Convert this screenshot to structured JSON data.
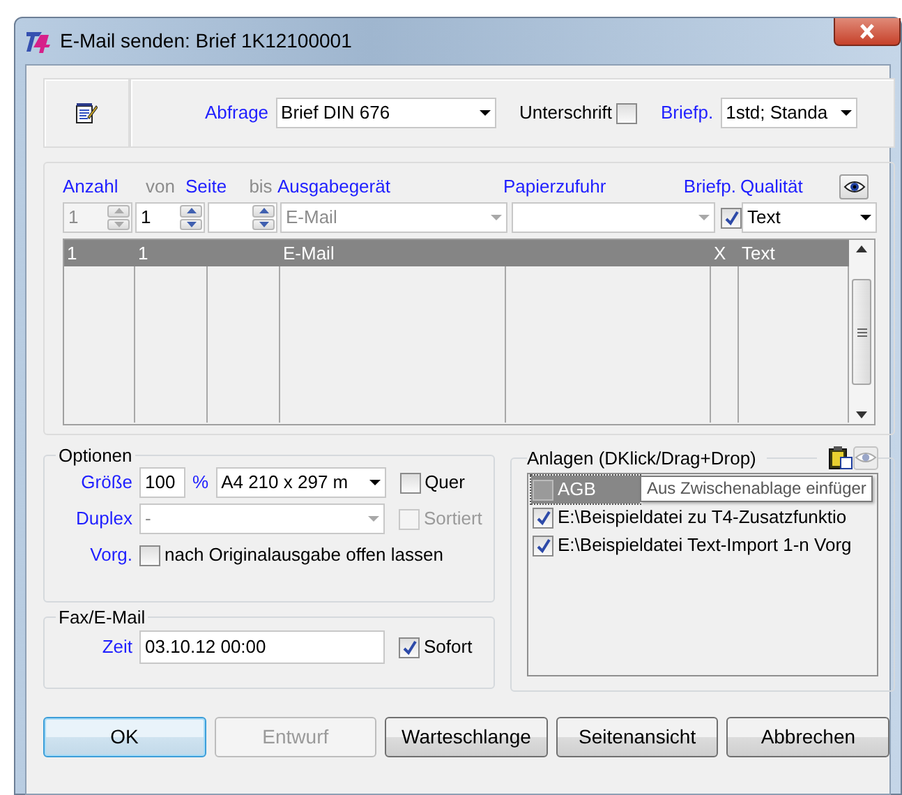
{
  "window": {
    "title": "E-Mail senden: Brief 1K12100001"
  },
  "query": {
    "label": "Abfrage",
    "value": "Brief DIN 676",
    "signature": {
      "label": "Unterschrift",
      "checked": false
    },
    "letterhead_label": "Briefp.",
    "letterhead_value": "1std; Standa"
  },
  "output": {
    "header_labels": [
      {
        "label": "Anzahl",
        "disabled": false
      },
      {
        "label": "von",
        "disabled": true
      },
      {
        "label": "Seite",
        "disabled": false
      },
      {
        "label": "bis",
        "disabled": true
      },
      {
        "label": "Ausgabegerät",
        "disabled": false
      },
      {
        "label": "Papierzufuhr",
        "disabled": false
      },
      {
        "label": "Briefp.",
        "disabled": false
      },
      {
        "label": "Qualität",
        "disabled": false
      }
    ],
    "editor": {
      "count": {
        "value": "1",
        "disabled": true
      },
      "from": {
        "value": "1",
        "disabled": false
      },
      "to": {
        "disabled": false
      },
      "device": {
        "value": "E-Mail",
        "disabled": true
      },
      "paper": {
        "disabled": true
      },
      "letterhead": {
        "checked": true
      },
      "quality": {
        "value": "Text"
      }
    },
    "list_rows": [
      {
        "cells": [
          "1",
          "1",
          "",
          "E-Mail",
          "",
          "X",
          "Text"
        ],
        "selected": true
      }
    ]
  },
  "options": {
    "title": "Optionen",
    "size_label": "Größe",
    "size_value": "100",
    "percent": "%",
    "format": "A4 210 x 297 m",
    "landscape": {
      "label": "Quer",
      "checked": false,
      "disabled": false
    },
    "duplex_label": "Duplex",
    "duplex_value": "-",
    "duplex_disabled": true,
    "sorted": {
      "label": "Sortiert",
      "checked": false,
      "disabled": true
    },
    "preset_label": "Vorg.",
    "keep_open": {
      "label": "nach Originalausgabe offen lassen",
      "checked": false
    }
  },
  "fax": {
    "title": "Fax/E-Mail",
    "time_label": "Zeit",
    "time_value": "03.10.12 00:00",
    "immediate": {
      "label": "Sofort",
      "checked": true
    }
  },
  "attachments": {
    "title": "Anlagen (DKlick/Drag+Drop)",
    "items": [
      {
        "label": "AGB",
        "checked": false,
        "selected": true
      },
      {
        "label": "E:\\Beispieldatei zu T4-Zusatzfunktio",
        "checked": true,
        "selected": false
      },
      {
        "label": "E:\\Beispieldatei Text-Import 1-n Vorg",
        "checked": true,
        "selected": false
      }
    ],
    "tooltip": "Aus Zwischenablage einfüger"
  },
  "buttons": [
    {
      "label": "OK",
      "default": true,
      "disabled": false
    },
    {
      "label": "Entwurf",
      "default": false,
      "disabled": true
    },
    {
      "label": "Warteschlange",
      "default": false,
      "disabled": false
    },
    {
      "label": "Seitenansicht",
      "default": false,
      "disabled": false
    },
    {
      "label": "Abbrechen",
      "default": false,
      "disabled": false
    }
  ]
}
